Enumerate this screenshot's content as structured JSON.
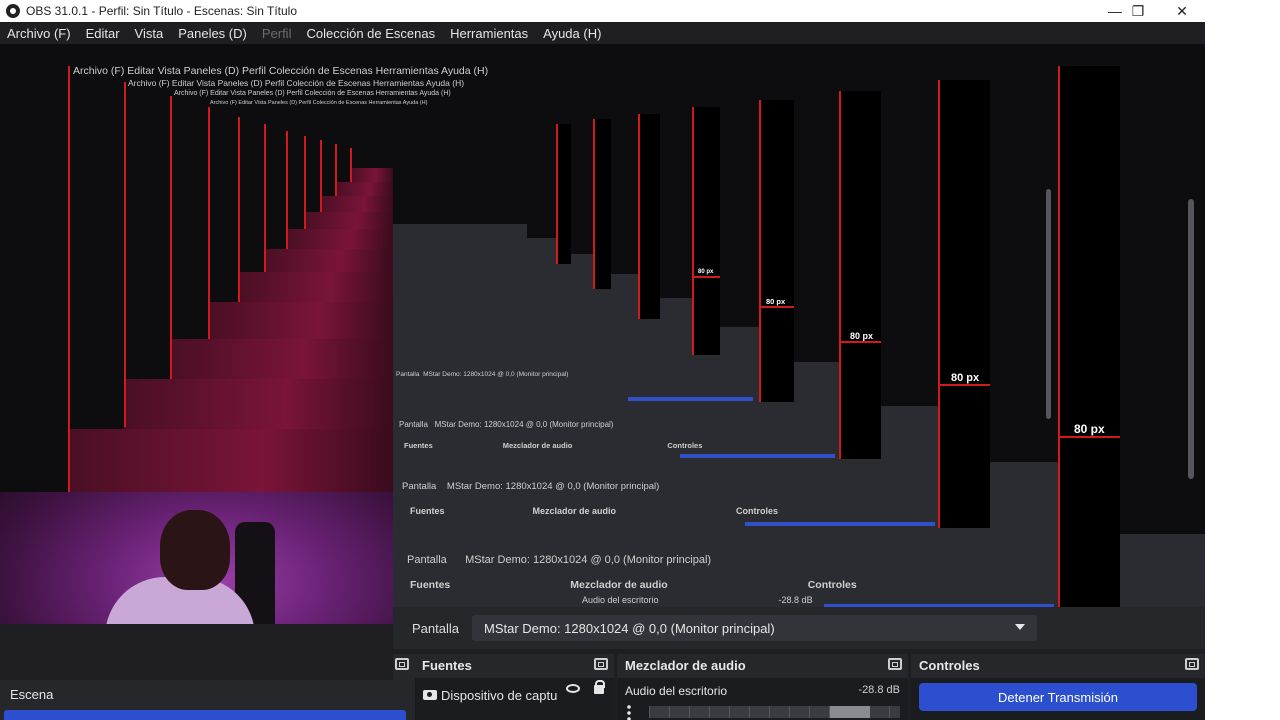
{
  "titlebar": {
    "title": "OBS 31.0.1 - Perfil: Sin Título - Escenas: Sin Título",
    "minimize": "—",
    "restore": "❐",
    "close": "✕"
  },
  "menu": {
    "items": [
      {
        "label": "Archivo (F)",
        "enabled": true
      },
      {
        "label": "Editar",
        "enabled": true
      },
      {
        "label": "Vista",
        "enabled": true
      },
      {
        "label": "Paneles (D)",
        "enabled": true
      },
      {
        "label": "Perfil",
        "enabled": false
      },
      {
        "label": "Colección de Escenas",
        "enabled": true
      },
      {
        "label": "Herramientas",
        "enabled": true
      },
      {
        "label": "Ayuda (H)",
        "enabled": true
      }
    ]
  },
  "preview": {
    "recursion_label": "80 px",
    "mini_menu": "Archivo (F)   Editar   Vista   Paneles (D)   Perfil   Colección de Escenas   Herramientas   Ayuda (H)",
    "mini_pantalla": "Pantalla",
    "mini_monitor": "MStar Demo: 1280x1024 @ 0,0 (Monitor principal)",
    "mini_fuentes": "Fuentes",
    "mini_mezclador": "Mezclador de audio",
    "mini_controles": "Controles",
    "mini_audio": "Audio del escritorio",
    "mini_db": "-28.8 dB"
  },
  "display_row": {
    "label": "Pantalla",
    "monitor_value": "MStar Demo: 1280x1024 @ 0,0 (Monitor principal)"
  },
  "docks": {
    "sources": {
      "title": "Fuentes",
      "items": [
        {
          "name": "Dispositivo de captu",
          "icon": "camera-icon"
        }
      ]
    },
    "mixer": {
      "title": "Mezclador de audio",
      "channel": "Audio del escritorio",
      "db": "-28.8 dB"
    },
    "controls": {
      "title": "Controles",
      "stream_button": "Detener Transmisión"
    },
    "scenes": {
      "title": "Escena"
    }
  },
  "colors": {
    "accent": "#2c4fd0",
    "border_red": "#d11a1a",
    "dock_bg": "#26272b"
  }
}
